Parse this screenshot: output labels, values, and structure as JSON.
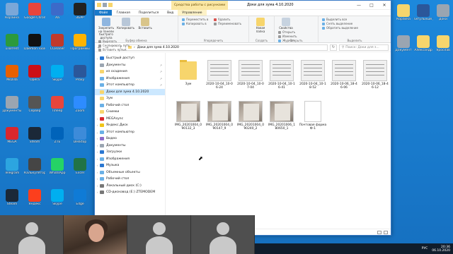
{
  "colors": {
    "desktop": "#1b7fd0",
    "ribbon_file_tab": "#1979ca",
    "manage_tab": "#fbe7a3",
    "folder": "#f7d56c",
    "selection": "#cce8ff",
    "taskbar": "#101d2c"
  },
  "desktop": {
    "left_icons": [
      {
        "label": "Корзина",
        "icon": "recycle-bin-icon",
        "color": "#7aa7d8"
      },
      {
        "label": "Google Chrome",
        "icon": "chrome-icon",
        "color": "#e8453c"
      },
      {
        "label": "Aa",
        "icon": "font-icon",
        "color": "#3c6ac9"
      },
      {
        "label": "3GPP",
        "icon": "video-icon",
        "color": "#222222"
      },
      {
        "label": "uTorrent",
        "icon": "utorrent-icon",
        "color": "#2c9a3d"
      },
      {
        "label": "Daemon Tools",
        "icon": "daemon-tools-icon",
        "color": "#111111"
      },
      {
        "label": "CCleaner",
        "icon": "ccleaner-icon",
        "color": "#c0392b"
      },
      {
        "label": "Программы",
        "icon": "program-icon",
        "color": "#ffb300"
      },
      {
        "label": "Mozilla",
        "icon": "firefox-icon",
        "color": "#e66000"
      },
      {
        "label": "Opera",
        "icon": "opera-icon",
        "color": "#cc0f16"
      },
      {
        "label": "Skype",
        "icon": "skype-icon",
        "color": "#00aff0"
      },
      {
        "label": "Proxy",
        "icon": "word-icon",
        "color": "#2b579a"
      },
      {
        "label": "Документы",
        "icon": "document-icon",
        "color": "#9aa5b1"
      },
      {
        "label": "Сервер",
        "icon": "server-icon",
        "color": "#555555"
      },
      {
        "label": "Плеер",
        "icon": "player-icon",
        "color": "#e8453c"
      },
      {
        "label": "Zoom",
        "icon": "zoom-icon",
        "color": "#2d8cff"
      },
      {
        "label": "MEGA",
        "icon": "mega-icon",
        "color": "#d9272e"
      },
      {
        "label": "Steam",
        "icon": "steam-icon",
        "color": "#1b2838"
      },
      {
        "label": "ZTE",
        "icon": "zte-icon",
        "color": "#0063ba"
      },
      {
        "label": "Desktop",
        "icon": "desktop-icon",
        "color": "#3d8bd9"
      },
      {
        "label": "Telegram",
        "icon": "telegram-icon",
        "color": "#2ca5e0"
      },
      {
        "label": "Калькулятор",
        "icon": "calculator-icon",
        "color": "#454545"
      },
      {
        "label": "WhatsApp",
        "icon": "whatsapp-icon",
        "color": "#25d366"
      },
      {
        "label": "Excel",
        "icon": "excel-icon",
        "color": "#217346"
      },
      {
        "label": "Steam",
        "icon": "steam-icon",
        "color": "#1b2838"
      },
      {
        "label": "Яндекс",
        "icon": "yandex-icon",
        "color": "#fc3f1d"
      },
      {
        "label": "Skype",
        "icon": "skype-icon",
        "color": "#00aff0"
      },
      {
        "label": "Edge",
        "icon": "edge-icon",
        "color": "#0f7bd6"
      }
    ],
    "right_icons": [
      {
        "label": "Корзина",
        "icon": "folder-icon",
        "color": "#f7d56c"
      },
      {
        "label": "Титульный для видео",
        "icon": "word-icon",
        "color": "#2b579a"
      },
      {
        "label": "Доки",
        "icon": "document-icon",
        "color": "#9aa5b1"
      },
      {
        "label": "Документ",
        "icon": "document-icon",
        "color": "#9aa5b1"
      },
      {
        "label": "Александр",
        "icon": "folder-icon",
        "color": "#f7d56c"
      },
      {
        "label": "Ярослав",
        "icon": "folder-icon",
        "color": "#f7d56c"
      }
    ]
  },
  "explorer": {
    "title": "Доки для зума 4.10.2020",
    "manage_header": "Средства работы с рисунками",
    "tabs": [
      "Файл",
      "Главная",
      "Поделиться",
      "Вид",
      "Управление"
    ],
    "ribbon": {
      "clipboard": {
        "pin_label": "Закрепить на панели быстрого доступа",
        "copy_label": "Копировать",
        "paste_label": "Вставить",
        "cut_label": "Вырезать",
        "copy_path_label": "Скопировать путь",
        "paste_shortcut_label": "Вставить ярлык",
        "group_name": "Буфер обмена"
      },
      "organize": {
        "move_label": "Переместить в",
        "copy_to_label": "Копировать в",
        "delete_label": "Удалить",
        "rename_label": "Переименовать",
        "group_name": "Упорядочить"
      },
      "create": {
        "new_folder_label": "Новая папка",
        "group_name": "Создать"
      },
      "open": {
        "properties_label": "Свойства",
        "open_label": "Открыть",
        "edit_label": "Изменить",
        "history_label": "Журнал",
        "group_name": "Открыть"
      },
      "select": {
        "select_all_label": "Выделить все",
        "select_none_label": "Снять выделение",
        "invert_label": "Обратить выделение",
        "group_name": "Выделить"
      }
    },
    "address": {
      "path": "Доки для зума 4.10.2020",
      "search_placeholder": "Поиск: Доки для з..."
    },
    "nav": [
      {
        "label": "Быстрый доступ",
        "icon": "star-icon",
        "color": "#2b77d1",
        "pin": false,
        "expand": "v",
        "selected": false
      },
      {
        "label": "Документы",
        "icon": "documents-icon",
        "color": "#9aa5b1",
        "pin": true,
        "expand": "",
        "selected": false
      },
      {
        "label": "из осадения",
        "icon": "folder-icon",
        "color": "#f7d56c",
        "pin": true,
        "expand": "",
        "selected": false
      },
      {
        "label": "Изображения",
        "icon": "pictures-icon",
        "color": "#6ab0e6",
        "pin": true,
        "expand": "",
        "selected": false
      },
      {
        "label": "Этот компьютер",
        "icon": "pc-icon",
        "color": "#6ab0e6",
        "pin": true,
        "expand": "",
        "selected": false
      },
      {
        "label": "Доки для зума 4.10.2020",
        "icon": "folder-icon",
        "color": "#f7d56c",
        "pin": false,
        "expand": "",
        "selected": true
      },
      {
        "label": "Зум",
        "icon": "folder-icon",
        "color": "#f7d56c",
        "pin": false,
        "expand": "",
        "selected": false
      },
      {
        "label": "Рабочий стол",
        "icon": "desktop-icon",
        "color": "#6ab0e6",
        "pin": false,
        "expand": "",
        "selected": false
      },
      {
        "label": "Снимки",
        "icon": "folder-icon",
        "color": "#f7d56c",
        "pin": false,
        "expand": "",
        "selected": false
      },
      {
        "label": "MEGAsync",
        "icon": "mega-icon",
        "color": "#d9272e",
        "pin": false,
        "expand": ">",
        "selected": false
      },
      {
        "label": "Яндекс.Диск",
        "icon": "yandex-disk-icon",
        "color": "#f0c419",
        "pin": false,
        "expand": ">",
        "selected": false
      },
      {
        "label": "Этот компьютер",
        "icon": "pc-icon",
        "color": "#6ab0e6",
        "pin": false,
        "expand": "v",
        "selected": false
      },
      {
        "label": "Видео",
        "icon": "video-icon",
        "color": "#8c6bc9",
        "pin": false,
        "expand": ">",
        "selected": false
      },
      {
        "label": "Документы",
        "icon": "documents-icon",
        "color": "#9aa5b1",
        "pin": false,
        "expand": ">",
        "selected": false
      },
      {
        "label": "Загрузки",
        "icon": "downloads-icon",
        "color": "#2b77d1",
        "pin": false,
        "expand": ">",
        "selected": false
      },
      {
        "label": "Изображения",
        "icon": "pictures-icon",
        "color": "#6ab0e6",
        "pin": false,
        "expand": ">",
        "selected": false
      },
      {
        "label": "Музыка",
        "icon": "music-icon",
        "color": "#2b77d1",
        "pin": false,
        "expand": ">",
        "selected": false
      },
      {
        "label": "Объемные объекты",
        "icon": "3d-objects-icon",
        "color": "#6ab0e6",
        "pin": false,
        "expand": ">",
        "selected": false
      },
      {
        "label": "Рабочий стол",
        "icon": "desktop-icon",
        "color": "#6ab0e6",
        "pin": false,
        "expand": ">",
        "selected": false
      },
      {
        "label": "Локальный диск (C:)",
        "icon": "drive-icon",
        "color": "#777777",
        "pin": false,
        "expand": ">",
        "selected": false
      },
      {
        "label": "CD-дисковод (E:) ZTEMODEM",
        "icon": "cd-drive-icon",
        "color": "#777777",
        "pin": false,
        "expand": ">",
        "selected": false
      }
    ],
    "files": [
      {
        "name": "Зум",
        "kind": "folder"
      },
      {
        "name": "2020-10-04_10-06-24",
        "kind": "screenshot"
      },
      {
        "name": "2020-10-04_10-07-04",
        "kind": "screenshot"
      },
      {
        "name": "2020-10-04_10-16-41",
        "kind": "screenshot"
      },
      {
        "name": "2020-10-04_10-18-52",
        "kind": "screenshot"
      },
      {
        "name": "2020-10-06_18-46-06",
        "kind": "screenshot"
      },
      {
        "name": "2020-10-06_18-46-12",
        "kind": "screenshot"
      },
      {
        "name": "IMG_20201004_090132_3",
        "kind": "photo"
      },
      {
        "name": "IMG_20201004_090147_9",
        "kind": "photo"
      },
      {
        "name": "IMG_20201004_090240_2",
        "kind": "photo"
      },
      {
        "name": "IMG_20201006_180650_1",
        "kind": "photo"
      },
      {
        "name": "Почтовая форма Ф-1",
        "kind": "doc"
      }
    ]
  },
  "taskbar": {
    "lang": "РУС",
    "time": "20:36",
    "date": "06.10.2020"
  }
}
